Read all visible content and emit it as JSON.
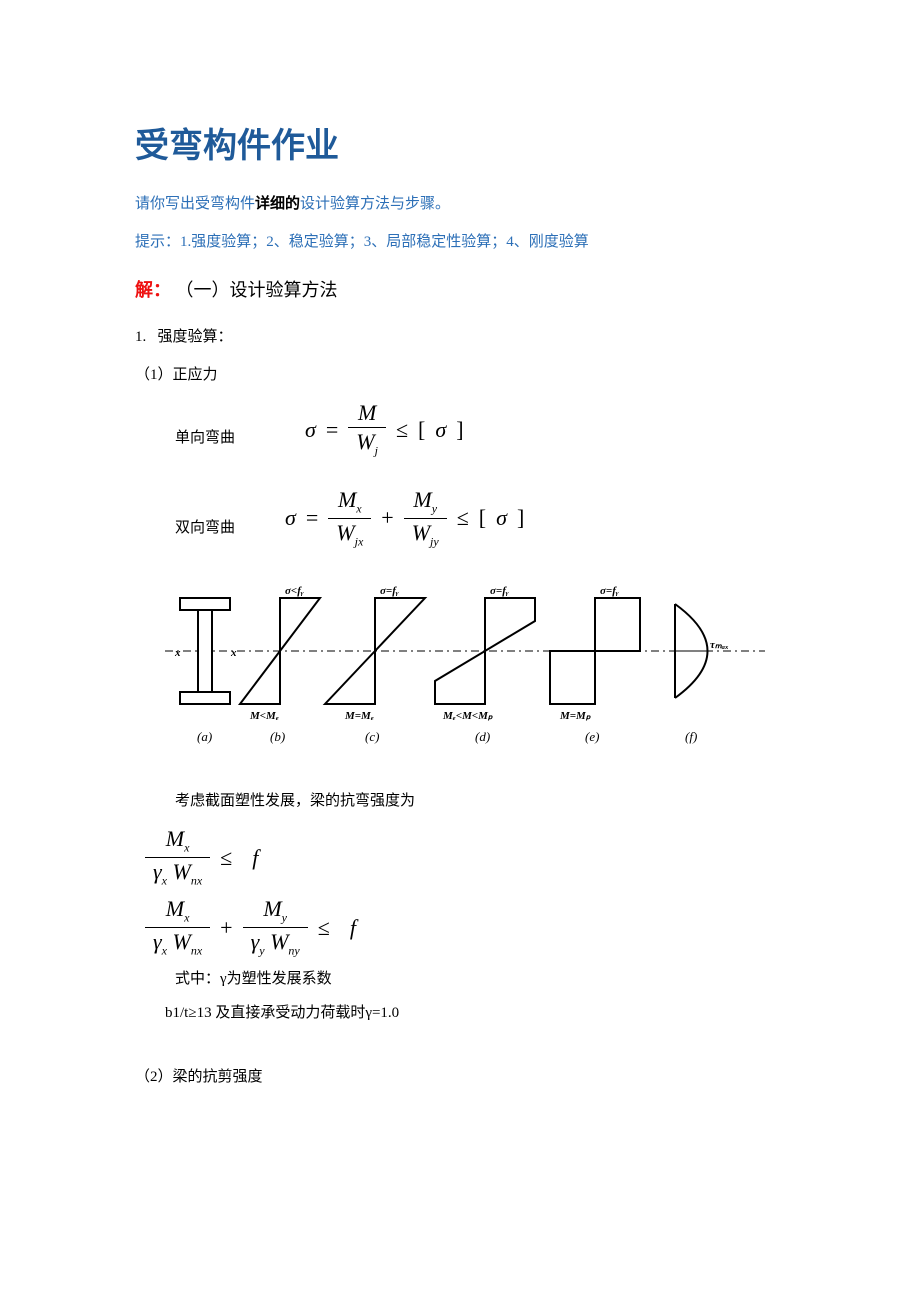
{
  "title": "受弯构件作业",
  "prompt_pre": "请你写出受弯构件",
  "prompt_bold": "详细的",
  "prompt_post": "设计验算方法与步骤。",
  "hint": "提示：1.强度验算；2、稳定验算；3、局部稳定性验算；4、刚度验算",
  "solution_label": "解：",
  "section_1": "（一）设计验算方法",
  "item_1_num": "1.",
  "item_1_text": "强度验算：",
  "sub_1_1": "（1）正应力",
  "eq1": {
    "label": "单向弯曲",
    "sigma": "σ",
    "eq": "=",
    "num": "M",
    "den_W": "W",
    "den_sub": "j",
    "le": "≤",
    "lbr": "[",
    "rbr": "]"
  },
  "eq2": {
    "label": "双向弯曲",
    "sigma": "σ",
    "eq": "=",
    "num1_M": "M",
    "num1_sub": "x",
    "den1_W": "W",
    "den1_sub": "jx",
    "plus": "+",
    "num2_M": "M",
    "num2_sub": "y",
    "den2_W": "W",
    "den2_sub": "jy",
    "le": "≤",
    "lbr": "[",
    "rbr": "]"
  },
  "diagram_labels": {
    "a": "(a)",
    "b": "(b)",
    "c": "(c)",
    "d": "(d)",
    "e": "(e)",
    "f": "(f)",
    "lt_fy_b": "σ<fᵧ",
    "eq_fy_c": "σ=fᵧ",
    "eq_fy_d": "σ=fᵧ",
    "eq_fy_e": "σ=fᵧ",
    "mm_b": "M<Mₑ",
    "mm_c": "M=Mₑ",
    "mm_d": "Mₑ<M<Mₚ",
    "mm_e": "M=Mₚ",
    "tau": "τₘₐₓ",
    "x": "x"
  },
  "para_plastic": "考虑截面塑性发展，梁的抗弯强度为",
  "eq3": {
    "num_M": "M",
    "num_sub": "x",
    "den_g": "γ",
    "den_g_sub": "x",
    "den_W": "W",
    "den_W_sub": "nx",
    "le": "≤",
    "f": "f"
  },
  "eq4": {
    "t1": {
      "num_M": "M",
      "num_sub": "x",
      "den_g": "γ",
      "den_g_sub": "x",
      "den_W": "W",
      "den_W_sub": "nx"
    },
    "plus": "+",
    "t2": {
      "num_M": "M",
      "num_sub": "y",
      "den_g": "γ",
      "den_g_sub": "y",
      "den_W": "W",
      "den_W_sub": "ny"
    },
    "le": "≤",
    "f": "f"
  },
  "gamma_note": "式中：γ为塑性发展系数",
  "bt_note": "b1/t≥13 及直接承受动力荷载时γ=1.0",
  "sub_1_2": "（2）梁的抗剪强度"
}
